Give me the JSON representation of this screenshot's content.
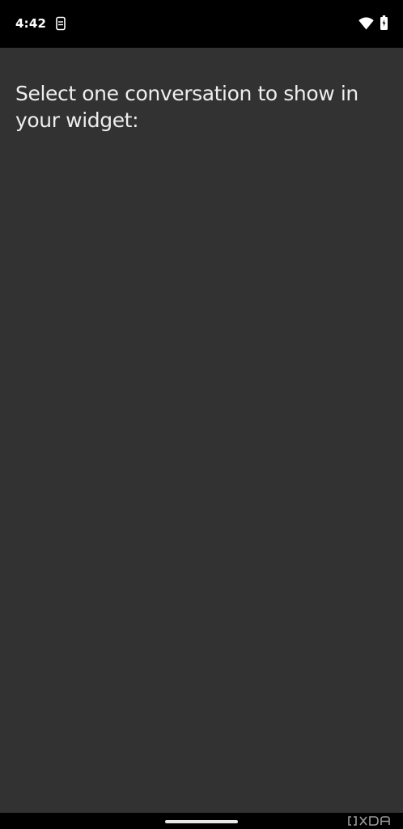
{
  "status_bar": {
    "time": "4:42",
    "notification_icon": "screenshot-notification-icon",
    "wifi_icon": "wifi-icon",
    "battery_icon": "battery-icon"
  },
  "main": {
    "prompt": "Select one conversation to show in your widget:"
  },
  "watermark": {
    "logo": "XDA"
  },
  "colors": {
    "background": "#323232",
    "status_bar": "#000000",
    "text": "#eeeeee"
  }
}
